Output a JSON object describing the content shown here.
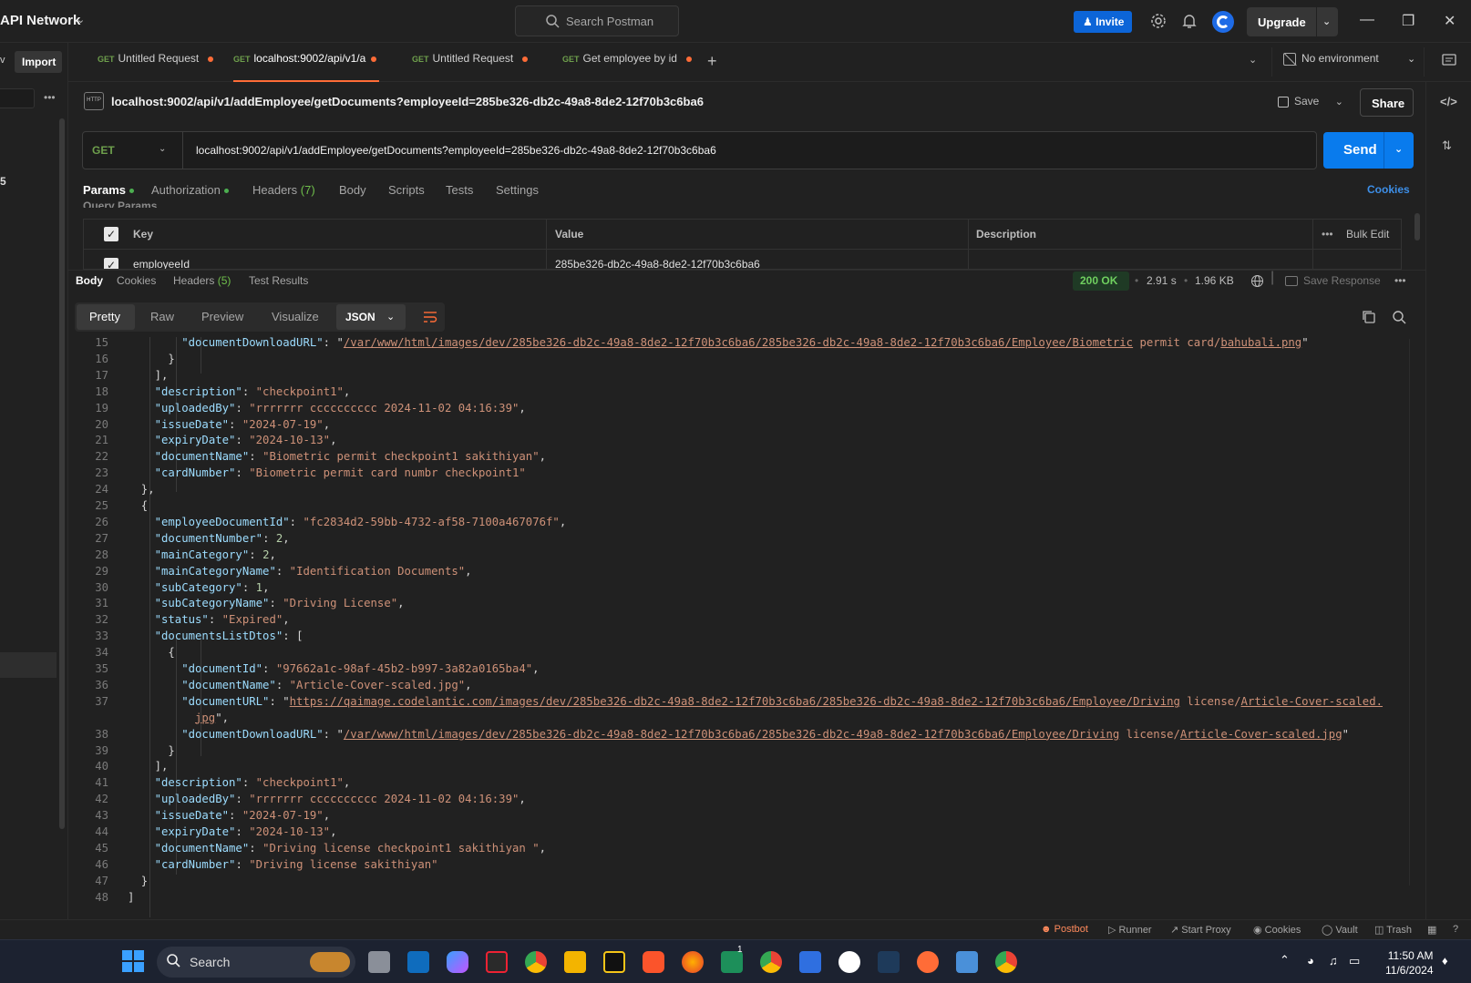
{
  "titlebar": {
    "workspace": "API Network",
    "search_placeholder": "Search Postman",
    "invite_label": "Invite",
    "upgrade_label": "Upgrade"
  },
  "sidebar": {
    "import_label": "Import",
    "count_fragment": "5"
  },
  "tabs": [
    {
      "method": "GET",
      "label": "Untitled Request",
      "active": false
    },
    {
      "method": "GET",
      "label": "localhost:9002/api/v1/a",
      "active": true
    },
    {
      "method": "GET",
      "label": "Untitled Request",
      "active": false
    },
    {
      "method": "GET",
      "label": "Get employee by id",
      "active": false
    }
  ],
  "environment": "No environment",
  "request": {
    "title": "localhost:9002/api/v1/addEmployee/getDocuments?employeeId=285be326-db2c-49a8-8de2-12f70b3c6ba6",
    "method": "GET",
    "url": "localhost:9002/api/v1/addEmployee/getDocuments?employeeId=285be326-db2c-49a8-8de2-12f70b3c6ba6",
    "save_label": "Save",
    "share_label": "Share",
    "send_label": "Send",
    "tabs": {
      "params": "Params",
      "auth": "Authorization",
      "headers": "Headers",
      "headers_count": "(7)",
      "body": "Body",
      "scripts": "Scripts",
      "tests": "Tests",
      "settings": "Settings"
    },
    "cookies_label": "Cookies",
    "query_params_label": "Query Params",
    "table": {
      "key": "Key",
      "value": "Value",
      "description": "Description",
      "bulk_edit": "Bulk Edit"
    },
    "param_row": {
      "key": "employeeId",
      "value": "285be326-db2c-49a8-8de2-12f70b3c6ba6"
    }
  },
  "response": {
    "tabs": {
      "body": "Body",
      "cookies": "Cookies",
      "headers": "Headers",
      "headers_count": "(5)",
      "test_results": "Test Results"
    },
    "status": "200 OK",
    "time": "2.91 s",
    "size": "1.96 KB",
    "save_response": "Save Response",
    "views": {
      "pretty": "Pretty",
      "raw": "Raw",
      "preview": "Preview",
      "visualize": "Visualize"
    },
    "format": "JSON",
    "lines": [
      {
        "n": "15",
        "indent": 8,
        "html": "<span class='k'>\"documentDownloadURL\"</span>: \"<span class='u'>/var/www/html/images/dev/285be326-db2c-49a8-8de2-12f70b3c6ba6/285be326-db2c-49a8-8de2-12f70b3c6ba6/Employee/Biometric</span><span class='s'> permit card/</span><span class='u'>bahubali.png</span>\""
      },
      {
        "n": "16",
        "indent": 6,
        "html": "}"
      },
      {
        "n": "17",
        "indent": 4,
        "html": "],"
      },
      {
        "n": "18",
        "indent": 4,
        "html": "<span class='k'>\"description\"</span>: <span class='s'>\"checkpoint1\"</span>,"
      },
      {
        "n": "19",
        "indent": 4,
        "html": "<span class='k'>\"uploadedBy\"</span>: <span class='s'>\"rrrrrrr cccccccccc 2024-11-02 04:16:39\"</span>,"
      },
      {
        "n": "20",
        "indent": 4,
        "html": "<span class='k'>\"issueDate\"</span>: <span class='s'>\"2024-07-19\"</span>,"
      },
      {
        "n": "21",
        "indent": 4,
        "html": "<span class='k'>\"expiryDate\"</span>: <span class='s'>\"2024-10-13\"</span>,"
      },
      {
        "n": "22",
        "indent": 4,
        "html": "<span class='k'>\"documentName\"</span>: <span class='s'>\"Biometric permit checkpoint1 sakithiyan\"</span>,"
      },
      {
        "n": "23",
        "indent": 4,
        "html": "<span class='k'>\"cardNumber\"</span>: <span class='s'>\"Biometric permit card numbr checkpoint1\"</span>"
      },
      {
        "n": "24",
        "indent": 2,
        "html": "},"
      },
      {
        "n": "25",
        "indent": 2,
        "html": "{"
      },
      {
        "n": "26",
        "indent": 4,
        "html": "<span class='k'>\"employeeDocumentId\"</span>: <span class='s'>\"fc2834d2-59bb-4732-af58-7100a467076f\"</span>,"
      },
      {
        "n": "27",
        "indent": 4,
        "html": "<span class='k'>\"documentNumber\"</span>: <span class='n'>2</span>,"
      },
      {
        "n": "28",
        "indent": 4,
        "html": "<span class='k'>\"mainCategory\"</span>: <span class='n'>2</span>,"
      },
      {
        "n": "29",
        "indent": 4,
        "html": "<span class='k'>\"mainCategoryName\"</span>: <span class='s'>\"Identification Documents\"</span>,"
      },
      {
        "n": "30",
        "indent": 4,
        "html": "<span class='k'>\"subCategory\"</span>: <span class='n'>1</span>,"
      },
      {
        "n": "31",
        "indent": 4,
        "html": "<span class='k'>\"subCategoryName\"</span>: <span class='s'>\"Driving License\"</span>,"
      },
      {
        "n": "32",
        "indent": 4,
        "html": "<span class='k'>\"status\"</span>: <span class='s'>\"Expired\"</span>,"
      },
      {
        "n": "33",
        "indent": 4,
        "html": "<span class='k'>\"documentsListDtos\"</span>: ["
      },
      {
        "n": "34",
        "indent": 6,
        "html": "{"
      },
      {
        "n": "35",
        "indent": 8,
        "html": "<span class='k'>\"documentId\"</span>: <span class='s'>\"97662a1c-98af-45b2-b997-3a82a0165ba4\"</span>,"
      },
      {
        "n": "36",
        "indent": 8,
        "html": "<span class='k'>\"documentName\"</span>: <span class='s'>\"Article-Cover-scaled.jpg\"</span>,"
      },
      {
        "n": "37",
        "indent": 8,
        "html": "<span class='k'>\"documentURL\"</span>: \"<span class='u'>https://qaimage.codelantic.com/images/dev/285be326-db2c-49a8-8de2-12f70b3c6ba6/285be326-db2c-49a8-8de2-12f70b3c6ba6/Employee/Driving</span><span class='s'> license/</span><span class='u'>Article-Cover-scaled.</span>"
      },
      {
        "n": "",
        "indent": 10,
        "html": "<span class='u'>jpg</span>\","
      },
      {
        "n": "38",
        "indent": 8,
        "html": "<span class='k'>\"documentDownloadURL\"</span>: \"<span class='u'>/var/www/html/images/dev/285be326-db2c-49a8-8de2-12f70b3c6ba6/285be326-db2c-49a8-8de2-12f70b3c6ba6/Employee/Driving</span><span class='s'> license/</span><span class='u'>Article-Cover-scaled.jpg</span>\""
      },
      {
        "n": "39",
        "indent": 6,
        "html": "}"
      },
      {
        "n": "40",
        "indent": 4,
        "html": "],"
      },
      {
        "n": "41",
        "indent": 4,
        "html": "<span class='k'>\"description\"</span>: <span class='s'>\"checkpoint1\"</span>,"
      },
      {
        "n": "42",
        "indent": 4,
        "html": "<span class='k'>\"uploadedBy\"</span>: <span class='s'>\"rrrrrrr cccccccccc 2024-11-02 04:16:39\"</span>,"
      },
      {
        "n": "43",
        "indent": 4,
        "html": "<span class='k'>\"issueDate\"</span>: <span class='s'>\"2024-07-19\"</span>,"
      },
      {
        "n": "44",
        "indent": 4,
        "html": "<span class='k'>\"expiryDate\"</span>: <span class='s'>\"2024-10-13\"</span>,"
      },
      {
        "n": "45",
        "indent": 4,
        "html": "<span class='k'>\"documentName\"</span>: <span class='s'>\"Driving license checkpoint1 sakithiyan \"</span>,"
      },
      {
        "n": "46",
        "indent": 4,
        "html": "<span class='k'>\"cardNumber\"</span>: <span class='s'>\"Driving license sakithiyan\"</span>"
      },
      {
        "n": "47",
        "indent": 2,
        "html": "}"
      },
      {
        "n": "48",
        "indent": 0,
        "html": "]"
      }
    ]
  },
  "statusbar": {
    "postbot": "Postbot",
    "runner": "Runner",
    "proxy": "Start Proxy",
    "cookies": "Cookies",
    "vault": "Vault",
    "trash": "Trash"
  },
  "taskbar": {
    "search_label": "Search",
    "time": "11:50 AM",
    "date": "11/6/2024",
    "badge": "1"
  },
  "colors": {
    "accent": "#ff6c37",
    "send": "#097bed",
    "method_get": "#6e9f4c",
    "status_ok": "#6fcf5f"
  }
}
